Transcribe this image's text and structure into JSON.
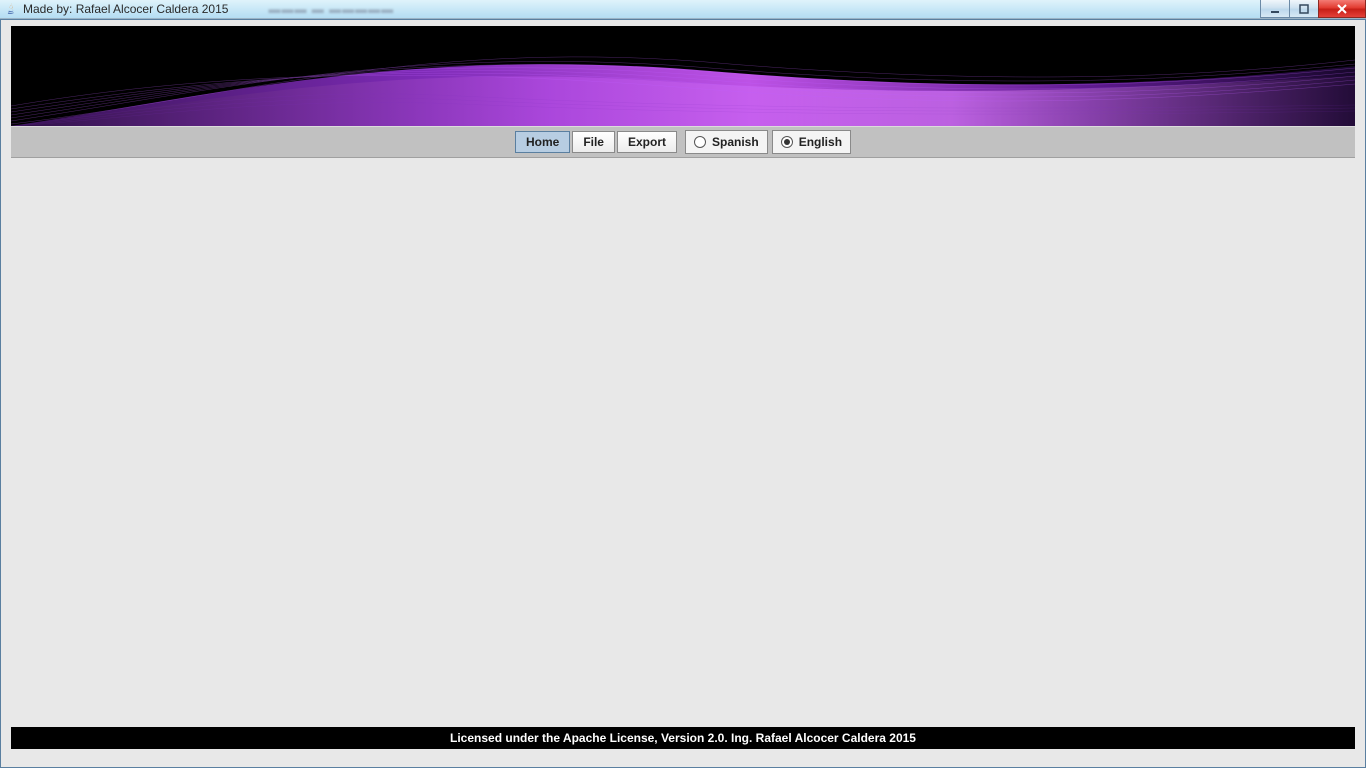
{
  "window": {
    "title": "Made by: Rafael Alcocer Caldera 2015"
  },
  "menu": {
    "home": "Home",
    "file": "File",
    "export": "Export"
  },
  "language": {
    "spanish": "Spanish",
    "english": "English",
    "selected": "english"
  },
  "footer": {
    "text": "Licensed under the Apache License, Version 2.0. Ing. Rafael Alcocer Caldera 2015"
  }
}
